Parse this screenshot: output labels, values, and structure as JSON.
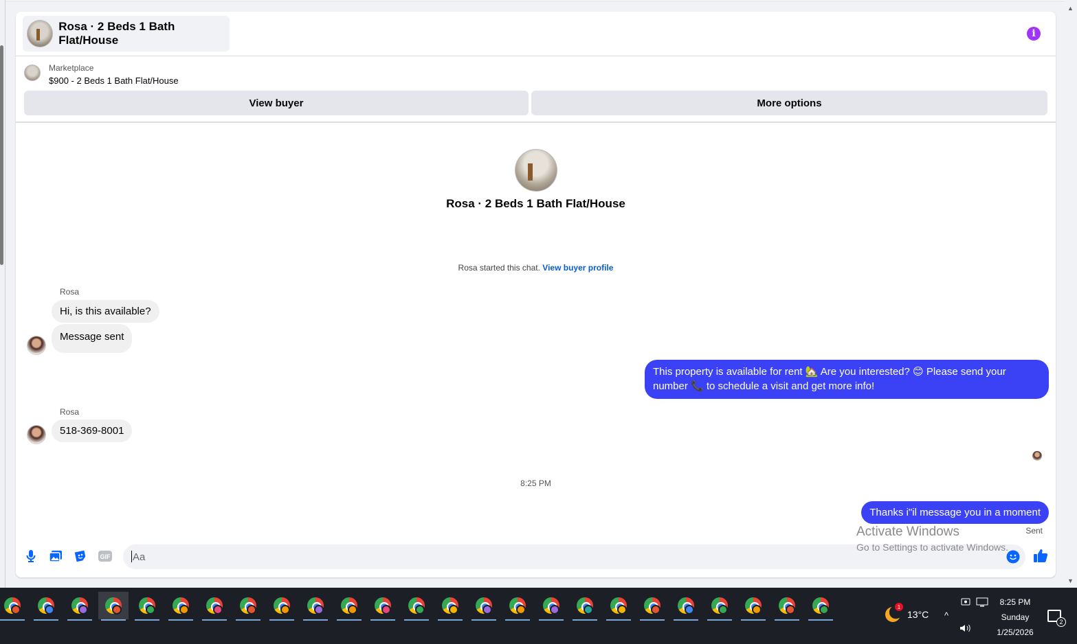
{
  "header": {
    "title": "Rosa · 2 Beds 1 Bath Flat/House"
  },
  "listing": {
    "label": "Marketplace",
    "price_line": "$900 - 2 Beds 1 Bath Flat/House",
    "view_buyer_label": "View buyer",
    "more_options_label": "More options"
  },
  "chat": {
    "intro_title": "Rosa · 2 Beds 1 Bath Flat/House",
    "started_text": "Rosa started this chat.",
    "started_link": "View buyer profile",
    "messages": [
      {
        "sender": "Rosa",
        "text": "Hi, is this available?",
        "direction": "in"
      },
      {
        "sender": "Rosa",
        "text": "Message sent",
        "direction": "in"
      },
      {
        "sender": "me",
        "text": "This property is available for rent 🏡 Are you interested? 😊 Please send your number 📞 to schedule a visit and get more info!",
        "direction": "out"
      },
      {
        "sender": "Rosa",
        "text": "518-369-8001",
        "direction": "in"
      },
      {
        "sender": "me",
        "text": "Thanks i\"il message you in a moment",
        "direction": "out"
      }
    ],
    "sender_name": "Rosa",
    "time_separator": "8:25 PM",
    "sent_status": "Sent"
  },
  "composer": {
    "placeholder": "Aa"
  },
  "watermark": {
    "line1": "Activate Windows",
    "line2": "Go to Settings to activate Windows."
  },
  "taskbar": {
    "app_count": 25,
    "weather_temp": "13°C",
    "weather_badge": "1",
    "time": "8:25 PM",
    "day": "Sunday",
    "date": "1/25/2026",
    "notification_count": "2"
  },
  "colors": {
    "accent": "#3b41f5",
    "info": "#a033ff",
    "link": "#0a5cc7",
    "like": "#0866ff"
  }
}
